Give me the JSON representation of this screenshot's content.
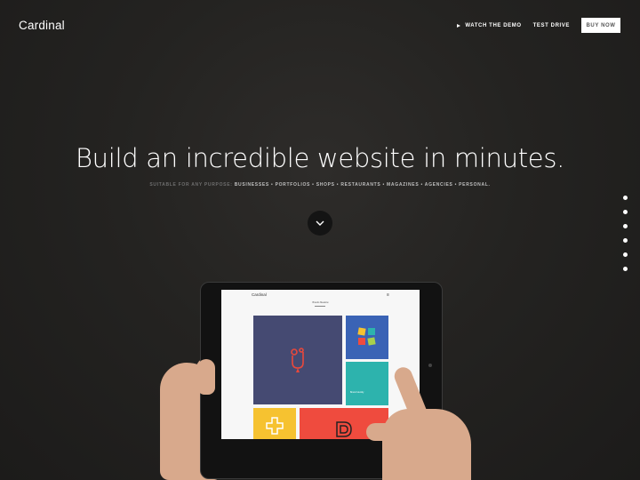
{
  "header": {
    "logo": "Cardinal",
    "nav": {
      "watch_demo": "WATCH THE DEMO",
      "test_drive": "TEST DRIVE",
      "buy_now": "BUY NOW"
    }
  },
  "hero": {
    "headline": "Build an incredible website in minutes.",
    "subline_prefix": "SUITABLE FOR ANY PURPOSE:",
    "subline_items": "BUSINESSES • PORTFOLIOS • SHOPS • RESTAURANTS • MAGAZINES • AGENCIES • PERSONAL.",
    "scroll_icon": "chevron-down-icon"
  },
  "pagination": {
    "count": 6,
    "active": 0
  },
  "tablet_screen": {
    "logo": "Cardinal",
    "menu_icon": "≡",
    "title": "Brands Meadow",
    "teal_tile_caption": "Brand Identity"
  },
  "colors": {
    "background": "#222120",
    "navy_tile": "#454a72",
    "blue_tile": "#3a63b5",
    "teal_tile": "#2db3ad",
    "yellow_tile": "#f6c230",
    "red_tile": "#ef4b3e",
    "accent_red": "#e8483b"
  }
}
